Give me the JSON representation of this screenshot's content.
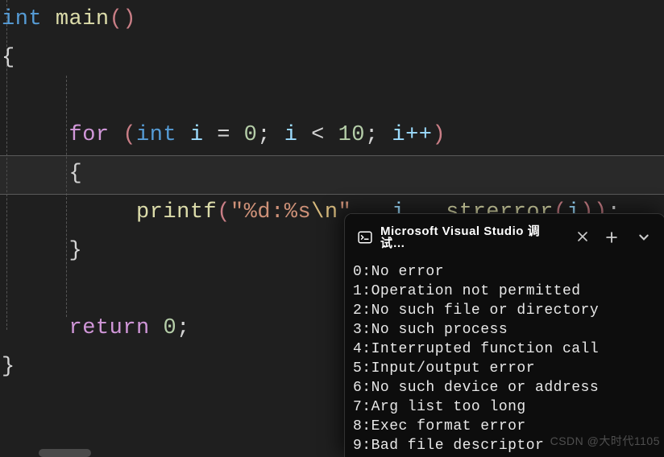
{
  "code": {
    "line1": {
      "kw_int": "int",
      "fn": "main",
      "paren": "()"
    },
    "line2": {
      "brace": "{"
    },
    "line3": {
      "kw_for": "for",
      "paren_o": "(",
      "typ": "int",
      "var": "i",
      "eq": "=",
      "zero": "0",
      "semi1": ";",
      "cmp": "<",
      "ten": "10",
      "semi2": ";",
      "inc": "i++",
      "paren_c": ")"
    },
    "line4": {
      "brace": "{"
    },
    "line5": {
      "fn": "printf",
      "paren_o": "(",
      "quote": "\"",
      "fmt1": "%d",
      ":": ":",
      "fmt2": "%s",
      "esc": "\\n",
      "quote2": "\"",
      "comma1": ",",
      "var_i": "i",
      "comma2": ",",
      "call": "strerror",
      "po": "(",
      "vi": "i",
      "pc": ")",
      "pc2": ")",
      "semi": ";"
    },
    "line6": {
      "brace": "}"
    },
    "line7": {
      "kw": "return",
      "zero": "0",
      "semi": ";"
    },
    "line8": {
      "brace": "}"
    }
  },
  "terminal": {
    "title": "Microsoft Visual Studio 调试…",
    "output": [
      "0:No error",
      "1:Operation not permitted",
      "2:No such file or directory",
      "3:No such process",
      "4:Interrupted function call",
      "5:Input/output error",
      "6:No such device or address",
      "7:Arg list too long",
      "8:Exec format error",
      "9:Bad file descriptor"
    ]
  },
  "watermark": "CSDN @大时代1105"
}
